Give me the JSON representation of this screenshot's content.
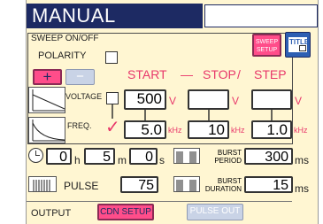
{
  "header": {
    "title": "MANUAL"
  },
  "top_buttons": {
    "sweep_setup": "SWEEP\nSETUP",
    "title": "TITLE"
  },
  "sweep": {
    "label": "SWEEP ON/OFF"
  },
  "polarity": {
    "label": "POLARITY",
    "plus": "+",
    "minus": "−"
  },
  "columns": {
    "start": "START",
    "dash": "—",
    "stop": "STOP",
    "slash": "/",
    "step": "STEP"
  },
  "voltage": {
    "label": "VOLTAGE",
    "start_value": "500",
    "stop_value": "",
    "step_value": "",
    "unit": "V"
  },
  "freq": {
    "label": "FREQ.",
    "start_value": "5.0",
    "stop_value": "10",
    "step_value": "1.0",
    "unit": "kHz",
    "checkmark": "✓"
  },
  "timer": {
    "hours": "0",
    "h": "h",
    "minutes": "5",
    "m": "m",
    "seconds": "0",
    "s": "s"
  },
  "burst_period": {
    "label_1": "BURST",
    "label_2": "PERIOD",
    "value": "300",
    "unit": "ms"
  },
  "pulse": {
    "label": "PULSE",
    "value": "75"
  },
  "burst_duration": {
    "label_1": "BURST",
    "label_2": "DURATION",
    "value": "15",
    "unit": "ms"
  },
  "output": {
    "label": "OUTPUT",
    "cdn_setup": "CDN SETUP",
    "pulse_out": "PULSE OUT"
  },
  "colors": {
    "title_bar": "#1d2a63",
    "panel_bg": "#fff6d2",
    "accent_pink": "#e8386b",
    "button_pink": "#ff4d8a"
  }
}
